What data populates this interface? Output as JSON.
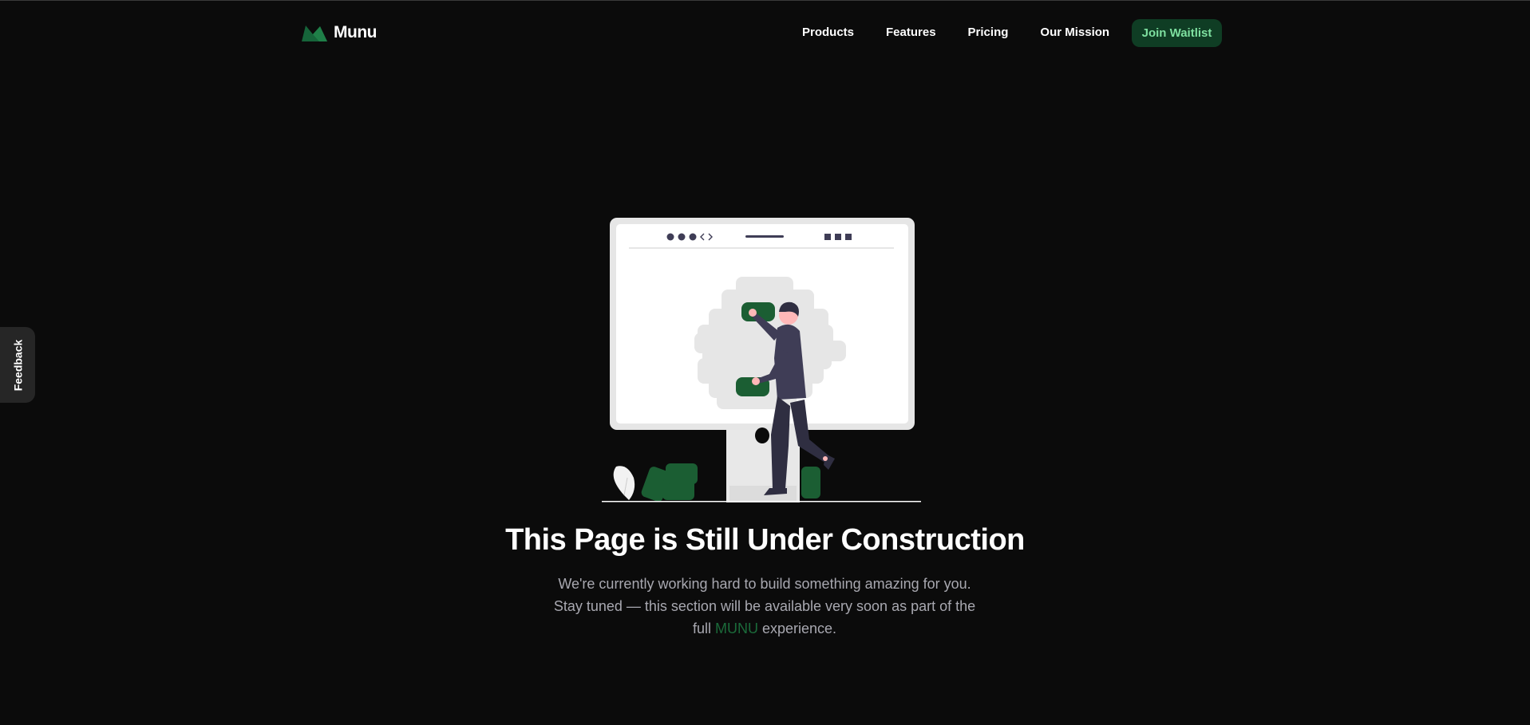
{
  "header": {
    "logo_text": "Munu",
    "nav": [
      "Products",
      "Features",
      "Pricing",
      "Our Mission"
    ],
    "cta_label": "Join Waitlist"
  },
  "feedback_tab": {
    "label": "Feedback"
  },
  "main": {
    "title": "This Page is Still Under Construction",
    "description_line1": "We're currently working hard to build something amazing for you.",
    "description_line2": "Stay tuned — this section will be available very soon as part of the",
    "description_line3_before": "full",
    "description_brand": "MUNU",
    "description_line3_after": "experience."
  },
  "colors": {
    "background": "#0b0b0b",
    "accent_green": "#1b6b3a",
    "cta_background": "#0f3d24",
    "cta_text": "#7ee0a0",
    "muted_text": "#a8a8b0"
  },
  "icons": {
    "logo": "munu-logo-mark",
    "illustration": "under-construction-illustration"
  }
}
